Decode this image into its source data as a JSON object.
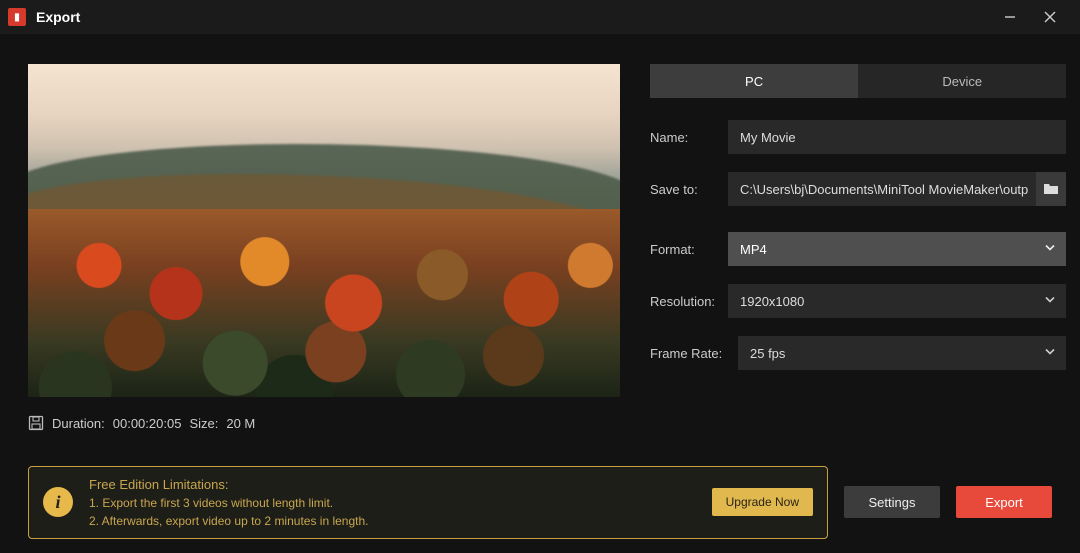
{
  "window": {
    "title": "Export"
  },
  "preview": {
    "duration_label": "Duration:",
    "duration_value": "00:00:20:05",
    "size_label": "Size:",
    "size_value": "20 M"
  },
  "tabs": {
    "pc": "PC",
    "device": "Device"
  },
  "form": {
    "name_label": "Name:",
    "name_value": "My Movie",
    "save_label": "Save to:",
    "save_value": "C:\\Users\\bj\\Documents\\MiniTool MovieMaker\\outp",
    "format_label": "Format:",
    "format_value": "MP4",
    "resolution_label": "Resolution:",
    "resolution_value": "1920x1080",
    "framerate_label": "Frame Rate:",
    "framerate_value": "25 fps"
  },
  "banner": {
    "heading": "Free Edition Limitations:",
    "line1": "1. Export the first 3 videos without length limit.",
    "line2": "2. Afterwards, export video up to 2 minutes in length.",
    "upgrade": "Upgrade Now"
  },
  "buttons": {
    "settings": "Settings",
    "export": "Export"
  }
}
